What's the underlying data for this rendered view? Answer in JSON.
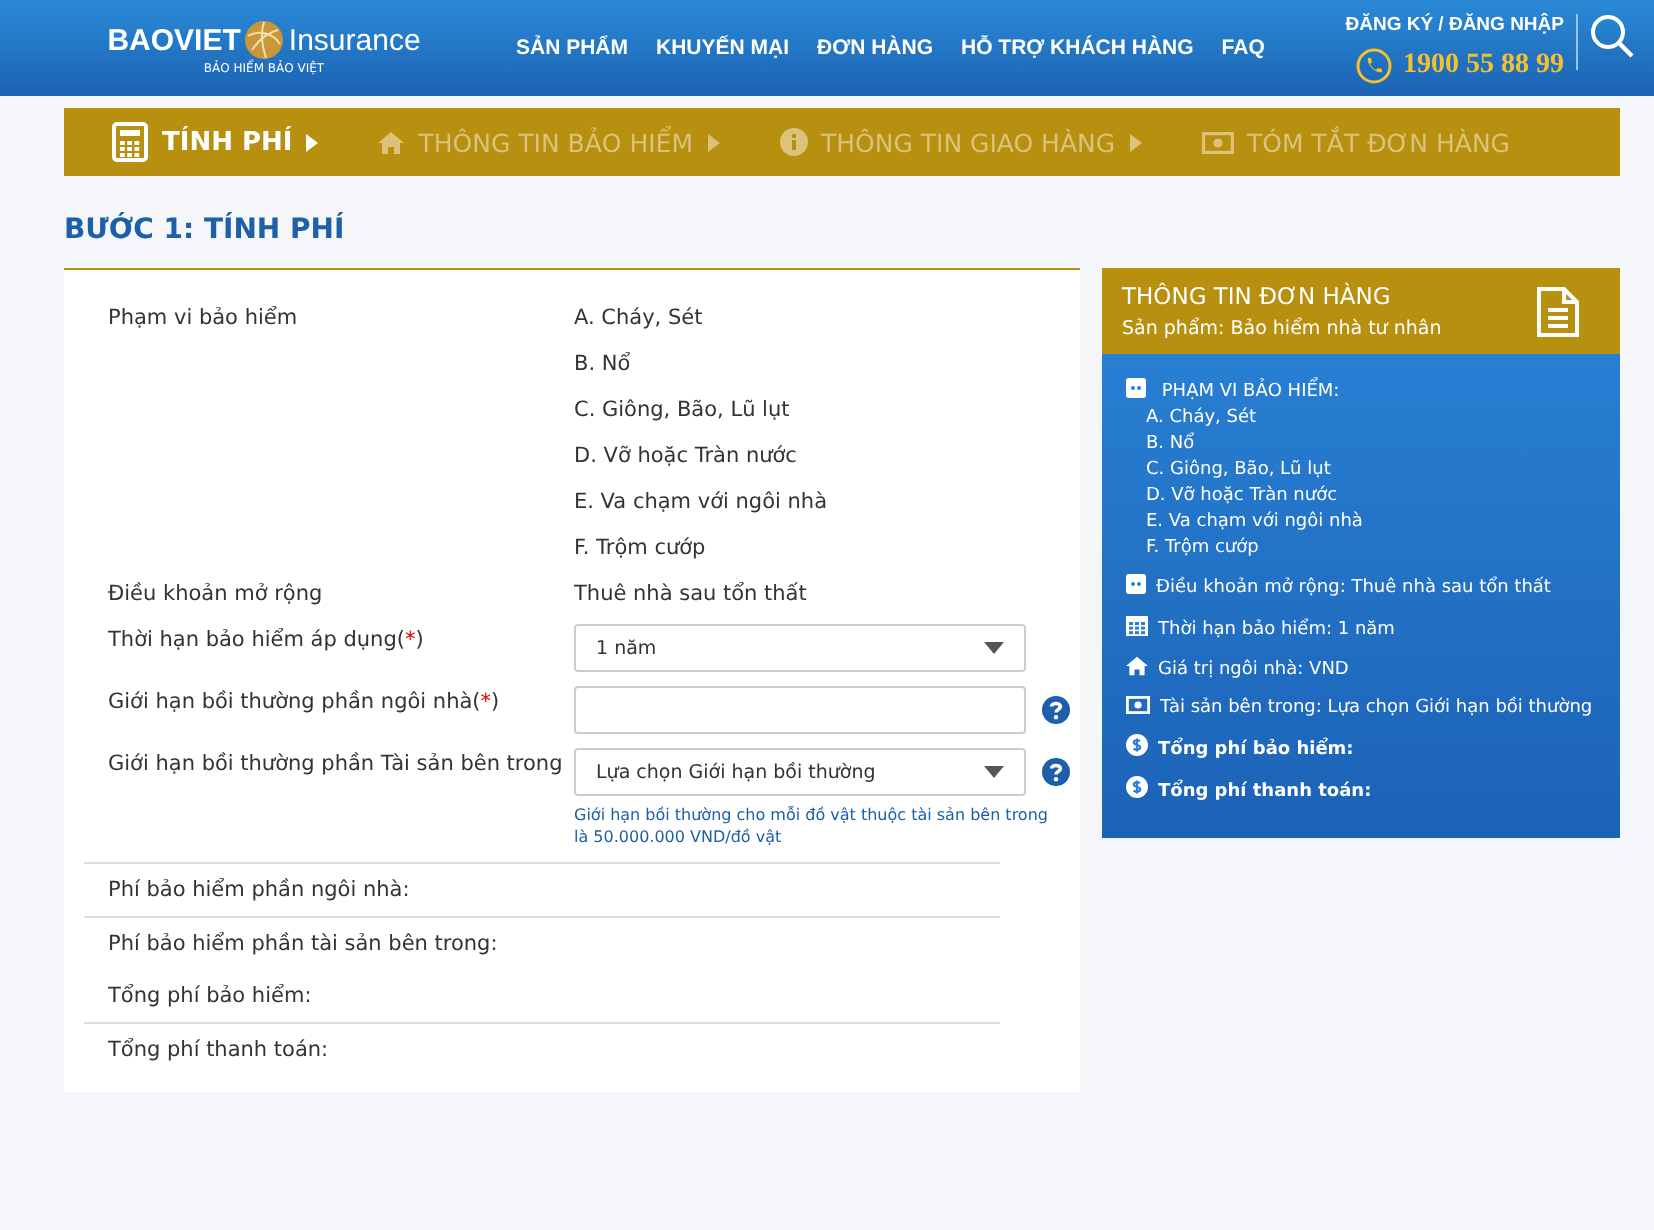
{
  "header": {
    "logo": {
      "brand": "BAOVIET",
      "suffix": "Insurance",
      "tagline": "BẢO HIỂM BẢO VIỆT"
    },
    "nav": [
      "SẢN PHẨM",
      "KHUYẾN MẠI",
      "ĐƠN HÀNG",
      "HỖ TRỢ KHÁCH HÀNG",
      "FAQ"
    ],
    "auth": "ĐĂNG KÝ / ĐĂNG NHẬP",
    "hotline": "1900 55 88 99"
  },
  "steps": [
    {
      "label": "TÍNH PHÍ",
      "selected": true
    },
    {
      "label": "THÔNG TIN BẢO HIỂM",
      "selected": false
    },
    {
      "label": "THÔNG TIN GIAO HÀNG",
      "selected": false
    },
    {
      "label": "TÓM TẮT ĐƠN HÀNG",
      "selected": false
    }
  ],
  "page_title": "BƯỚC 1: TÍNH PHÍ",
  "form": {
    "rows": [
      {
        "kind": "list",
        "label": "Phạm vi bảo hiểm",
        "values": [
          "A. Cháy, Sét",
          "B. Nổ",
          "C. Giông, Bão, Lũ lụt",
          "D. Vỡ hoặc Tràn nước",
          "E. Va chạm với ngôi nhà",
          "F. Trộm cướp"
        ]
      },
      {
        "kind": "text",
        "label": "Điều khoản mở rộng",
        "value": "Thuê nhà sau tổn thất"
      },
      {
        "kind": "select",
        "label": "Thời hạn bảo hiểm áp dụng",
        "required": "(*)",
        "value": "1 năm"
      },
      {
        "kind": "input",
        "label": "Giới hạn bồi thường phần ngôi nhà",
        "required": "(*)",
        "help": true
      },
      {
        "kind": "select",
        "label": "Giới hạn bồi thường phần Tài sản bên trong",
        "value": "Lựa chọn Giới hạn bồi thường",
        "help": true,
        "hint": "Giới hạn bồi thường cho mỗi đồ vật thuộc tài sản bên trong là 50.000.000 VND/đồ vật"
      }
    ],
    "fees": [
      {
        "label": "Phí bảo hiểm phần ngôi nhà:",
        "divider": true
      },
      {
        "label": "Phí bảo hiểm phần tài sản bên trong:",
        "divider": true
      },
      {
        "label": "Tổng phí bảo hiểm:",
        "divider": false
      },
      {
        "label": "Tổng phí thanh toán:",
        "divider": true
      }
    ]
  },
  "summary": {
    "title": "THÔNG TIN ĐƠN HÀNG",
    "subtitle": "Sản phẩm: Bảo hiểm nhà tư nhân",
    "items": [
      {
        "kind": "list",
        "label": "PHẠM VI BẢO HIỂM:",
        "values": [
          "A. Cháy, Sét",
          "B. Nổ",
          "C. Giông, Bão, Lũ lụt",
          "D. Vỡ hoặc Tràn nước",
          "E. Va chạm với ngôi nhà",
          "F. Trộm cướp"
        ]
      },
      {
        "kind": "tag",
        "label": "Điều khoản mở rộng: Thuê nhà sau tổn thất"
      },
      {
        "kind": "calendar",
        "label": "Thời hạn bảo hiểm: 1 năm"
      },
      {
        "kind": "home",
        "label": "Giá trị ngôi nhà: VND"
      },
      {
        "kind": "money",
        "label": "Tài sản bên trong: Lựa chọn Giới hạn bồi thường"
      },
      {
        "kind": "total",
        "label": "Tổng phí bảo hiểm:"
      },
      {
        "kind": "total",
        "label": "Tổng phí thanh toán:"
      }
    ]
  }
}
